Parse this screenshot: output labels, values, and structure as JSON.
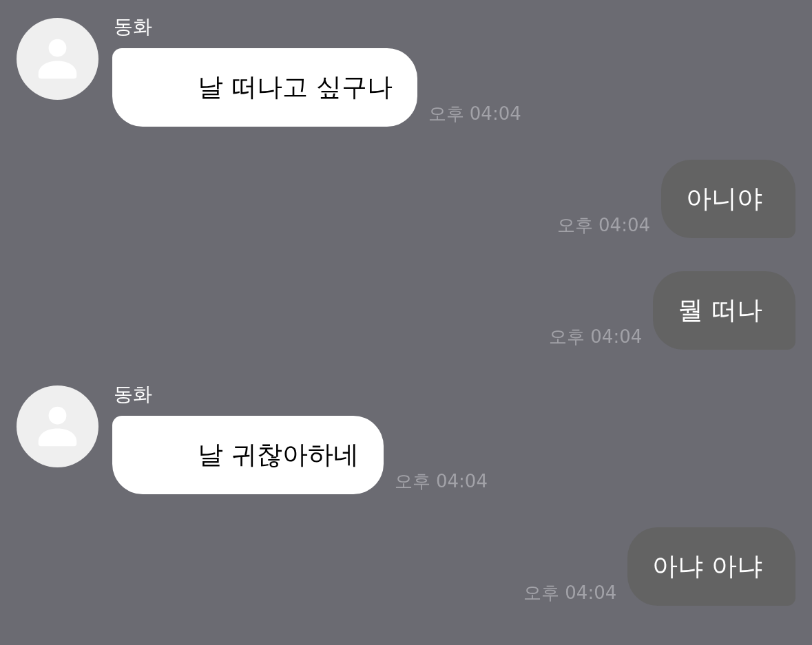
{
  "messages": [
    {
      "kind": "incoming",
      "sender": "동화",
      "text": "날 떠나고 싶구나",
      "time": "오후 04:04"
    },
    {
      "kind": "outgoing",
      "text": "아니야",
      "time": "오후 04:04"
    },
    {
      "kind": "outgoing",
      "text": "뭘 떠나",
      "time": "오후 04:04"
    },
    {
      "kind": "incoming",
      "sender": "동화",
      "text": "날 귀찮아하네",
      "time": "오후 04:04"
    },
    {
      "kind": "outgoing",
      "text": "아냐 아냐",
      "time": "오후 04:04"
    }
  ]
}
